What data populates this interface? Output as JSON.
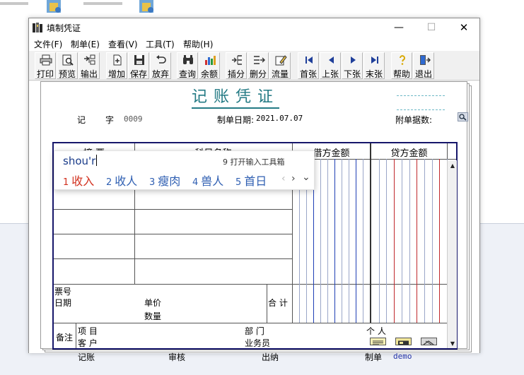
{
  "window": {
    "title": "填制凭证",
    "controls": {
      "minimize": "—",
      "maximize": "☐",
      "close": "✕"
    }
  },
  "menu": [
    {
      "label": "文件(F)"
    },
    {
      "label": "制单(E)"
    },
    {
      "label": "查看(V)"
    },
    {
      "label": "工具(T)"
    },
    {
      "label": "帮助(H)"
    }
  ],
  "toolbar": {
    "print": "打印",
    "preview": "预览",
    "export": "输出",
    "add": "增加",
    "save": "保存",
    "discard": "放弃",
    "query": "查询",
    "balance": "余额",
    "insert_row": "插分",
    "delete_row": "删分",
    "cashflow": "流量",
    "first": "首张",
    "prev": "上张",
    "next": "下张",
    "last": "末张",
    "help": "帮助",
    "exit": "退出"
  },
  "voucher": {
    "title": "记账凭证",
    "type_prefix": "记",
    "type_suffix": "字",
    "number": "0009",
    "date_label": "制单日期:",
    "date": "2021.07.07",
    "attachments_label": "附单据数:",
    "headers": {
      "summary": "摘 要",
      "account": "科目名称",
      "debit": "借方金额",
      "credit": "贷方金额"
    },
    "footer": {
      "ticket_no": "票号",
      "date": "日期",
      "unit_price": "单价",
      "quantity": "数量",
      "total": "合 计",
      "remark": "备注",
      "project": "项  目",
      "department": "部  门",
      "person": "个  人",
      "customer": "客  户",
      "salesperson": "业务员"
    },
    "signatures": {
      "bookkeeping": "记账",
      "review": "审核",
      "cashier": "出纳",
      "maker": "制单",
      "maker_name": "demo"
    }
  },
  "ime": {
    "composition": "shou'r",
    "hint": "9 打开输入工具箱",
    "candidates": [
      {
        "num": "1",
        "text": "收入"
      },
      {
        "num": "2",
        "text": "收人"
      },
      {
        "num": "3",
        "text": "瘦肉"
      },
      {
        "num": "4",
        "text": "兽人"
      },
      {
        "num": "5",
        "text": "首日"
      }
    ],
    "nav": {
      "prev": "‹",
      "next": "›",
      "expand": "⌄"
    }
  },
  "colors": {
    "accent_teal": "#237a84",
    "grid_border": "#16166a",
    "debit_major_line": "#1f3fb5",
    "credit_major_line": "#c0282c",
    "ime_selected": "#d2301e",
    "ime_candidate": "#2f5fb2"
  }
}
